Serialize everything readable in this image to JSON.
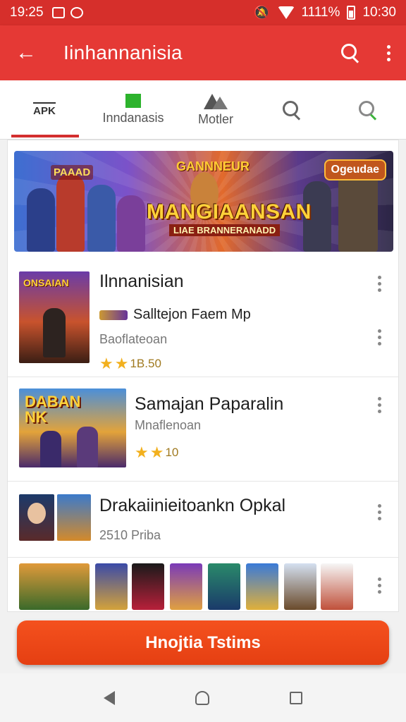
{
  "status_bar": {
    "time": "19:25",
    "battery_percent": "1111%",
    "clock": "10:30"
  },
  "app_bar": {
    "title": "Iinhannanisia"
  },
  "tabs": [
    {
      "label": "Inndanasis",
      "icon": "apk-icon",
      "icon_text": "APK",
      "active": true
    },
    {
      "label": "Inndanasis",
      "icon": "green-square-icon",
      "active": false
    },
    {
      "label": "Motler",
      "icon": "mountain-icon",
      "active": false
    },
    {
      "label": "",
      "icon": "search-icon",
      "active": false
    },
    {
      "label": "",
      "icon": "search-green-icon",
      "active": false
    }
  ],
  "banner": {
    "title": "MANGIAANSAN",
    "subtitle": "LIAE BRANNERANADD",
    "top_logo": "GANNNEUR",
    "left_logo": "PAAAD",
    "badge": "Ogeudae"
  },
  "items": [
    {
      "title": "Ilnnanisian",
      "subtitle": "Salltejon Faem Mp",
      "meta": "Baoflateoan",
      "rating": "1B.50",
      "thumb_text": "ONSAIAN"
    },
    {
      "title": "Samajan Paparalin",
      "meta": "Mnaflenoan",
      "rating": "10",
      "thumb_text": "DABAN NK"
    },
    {
      "title": "Drakaiinieitoankn Opkal",
      "meta": "2510 Priba"
    }
  ],
  "cta": {
    "label": "Hnojtia Tstims"
  },
  "colors": {
    "primary": "#e53935",
    "status": "#d62f2b",
    "accent": "#f4511e",
    "star": "#f2b01e"
  }
}
